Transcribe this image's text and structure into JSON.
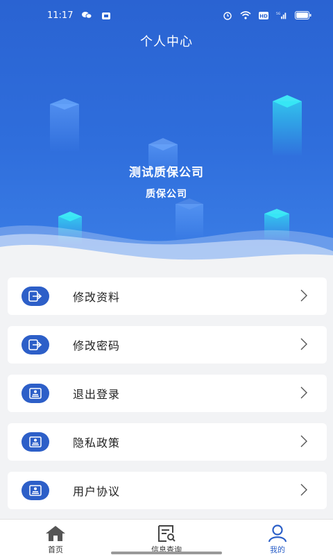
{
  "status_bar": {
    "time": "11:17"
  },
  "header": {
    "title": "个人中心"
  },
  "profile": {
    "company_name": "测试质保公司",
    "company_type": "质保公司"
  },
  "menu": [
    {
      "label": "修改资料",
      "icon": "exit-arrow-icon"
    },
    {
      "label": "修改密码",
      "icon": "exit-arrow-icon"
    },
    {
      "label": "退出登录",
      "icon": "id-card-icon"
    },
    {
      "label": "隐私政策",
      "icon": "id-card-icon"
    },
    {
      "label": "用户协议",
      "icon": "id-card-icon"
    }
  ],
  "tabbar": [
    {
      "label": "首页",
      "icon": "home-icon"
    },
    {
      "label": "信息查询",
      "icon": "document-search-icon"
    },
    {
      "label": "我的",
      "icon": "user-icon",
      "active": true
    }
  ],
  "colors": {
    "primary": "#2d5fc8",
    "hero": "#2f6edc",
    "accent": "#2b5fc8"
  }
}
